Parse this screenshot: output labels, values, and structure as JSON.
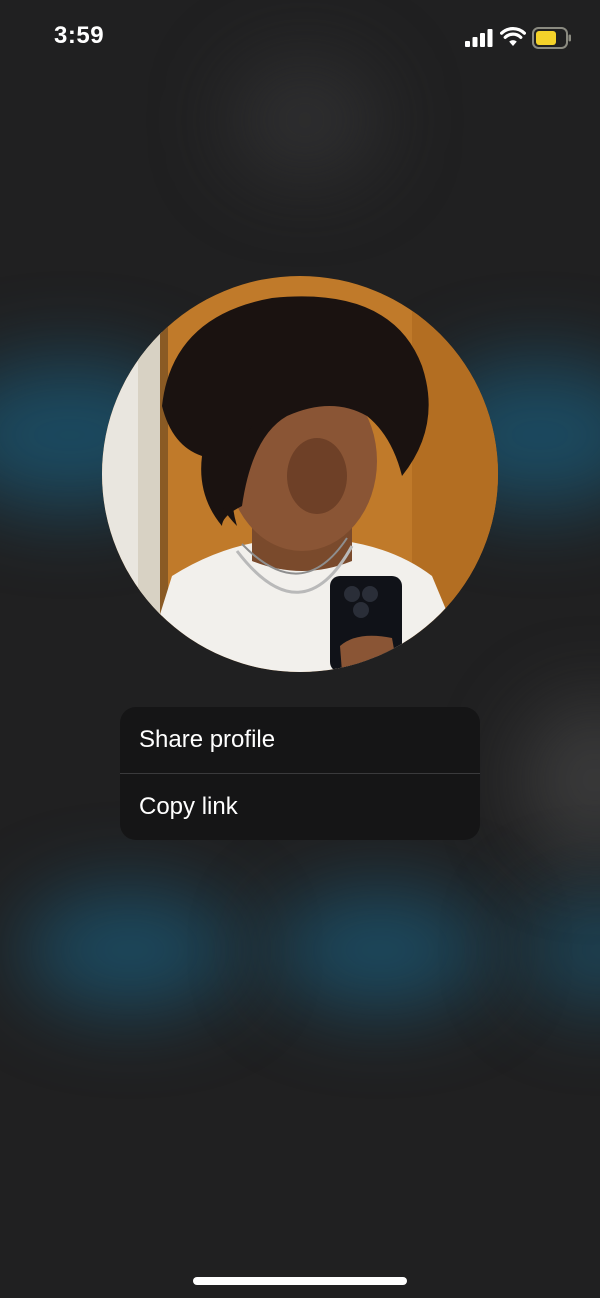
{
  "status_bar": {
    "time": "3:59",
    "icons": [
      "signal-icon",
      "wifi-icon",
      "battery-icon"
    ],
    "battery_color": "#f4d22a"
  },
  "profile": {
    "avatar": "profile-photo"
  },
  "menu": {
    "items": [
      {
        "label": "Share profile"
      },
      {
        "label": "Copy link"
      }
    ]
  },
  "colors": {
    "background": "#202021",
    "menu_background": "#151516",
    "accent_blur": "#186e96"
  }
}
